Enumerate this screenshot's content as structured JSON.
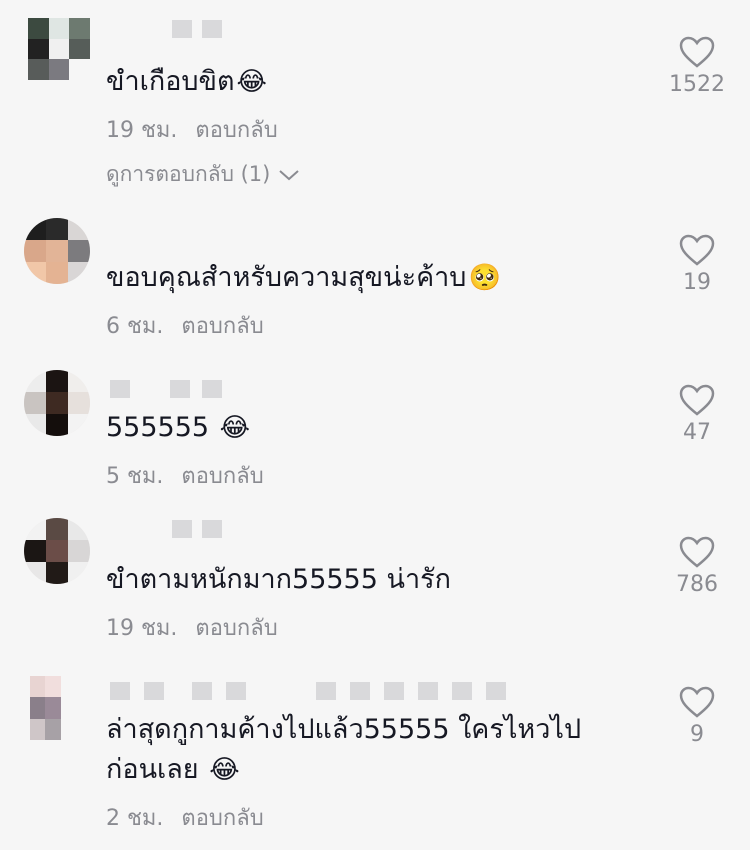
{
  "comments": [
    {
      "text": "ขำเกือบขิต",
      "emoji": "😂",
      "time": "19 ชม.",
      "reply_label": "ตอบกลับ",
      "view_replies": "ดูการตอบกลับ (1)",
      "likes": "1522"
    },
    {
      "text": "ขอบคุณสำหรับความสุขน่ะค้าบ",
      "emoji": "🥺",
      "time": "6 ชม.",
      "reply_label": "ตอบกลับ",
      "likes": "19"
    },
    {
      "text": "555555",
      "emoji": "😂",
      "time": "5 ชม.",
      "reply_label": "ตอบกลับ",
      "likes": "47"
    },
    {
      "text": "ขำตามหนักมาก55555 น่ารัก",
      "emoji": "",
      "time": "19 ชม.",
      "reply_label": "ตอบกลับ",
      "likes": "786"
    },
    {
      "text": "ล่าสุดกูกามค้างไปแล้ว55555 ใครไหวไป",
      "text_line2": "ก่อนเลย",
      "emoji": "😂",
      "time": "2 ชม.",
      "reply_label": "ตอบกลับ",
      "likes": "9"
    }
  ],
  "icons": {
    "like": "heart-outline-icon",
    "expand": "chevron-down-icon"
  },
  "colors": {
    "background": "#f6f6f6",
    "text": "#161823",
    "muted": "#8a8b91"
  }
}
